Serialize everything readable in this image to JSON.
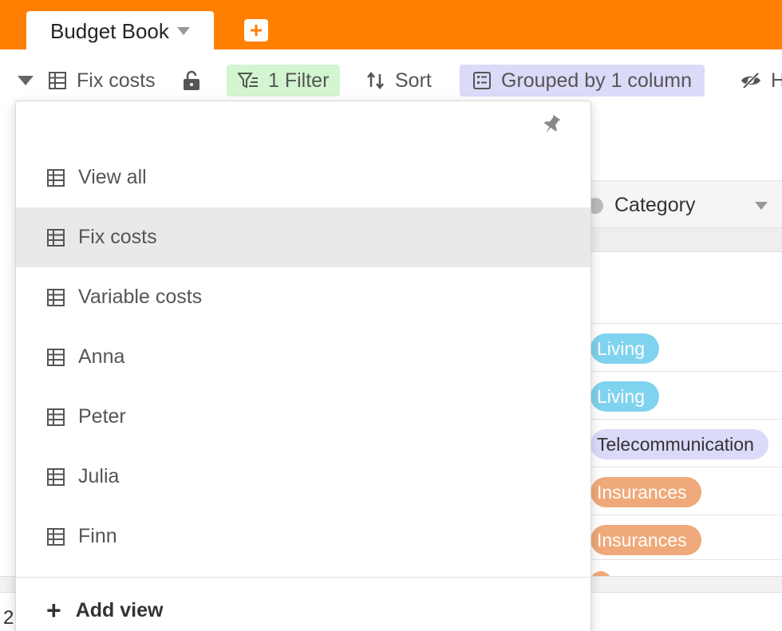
{
  "header": {
    "base_name": "Budget Book",
    "accent_color": "#ff7f00",
    "add_table_icon": "plus-icon"
  },
  "toolbar": {
    "current_view": "Fix costs",
    "lock_icon": "unlock-icon",
    "filter_label": "1 Filter",
    "sort_label": "Sort",
    "group_label": "Grouped by 1 column",
    "hide_label": "H"
  },
  "grid": {
    "column_header": "Category",
    "rows": [
      {
        "category": "Living",
        "color": "#7fd3ee"
      },
      {
        "category": "Living",
        "color": "#7fd3ee"
      },
      {
        "category": "Telecommunication",
        "color": "#dcdaf9"
      },
      {
        "category": "Insurances",
        "color": "#f0a97a"
      },
      {
        "category": "Insurances",
        "color": "#f0a97a"
      }
    ],
    "footer_count": "2"
  },
  "view_menu": {
    "pin_icon": "pin-icon",
    "views": [
      {
        "label": "View all",
        "active": false
      },
      {
        "label": "Fix costs",
        "active": true
      },
      {
        "label": "Variable costs",
        "active": false
      },
      {
        "label": "Anna",
        "active": false
      },
      {
        "label": "Peter",
        "active": false
      },
      {
        "label": "Julia",
        "active": false
      },
      {
        "label": "Finn",
        "active": false
      }
    ],
    "add_view_label": "Add view"
  }
}
